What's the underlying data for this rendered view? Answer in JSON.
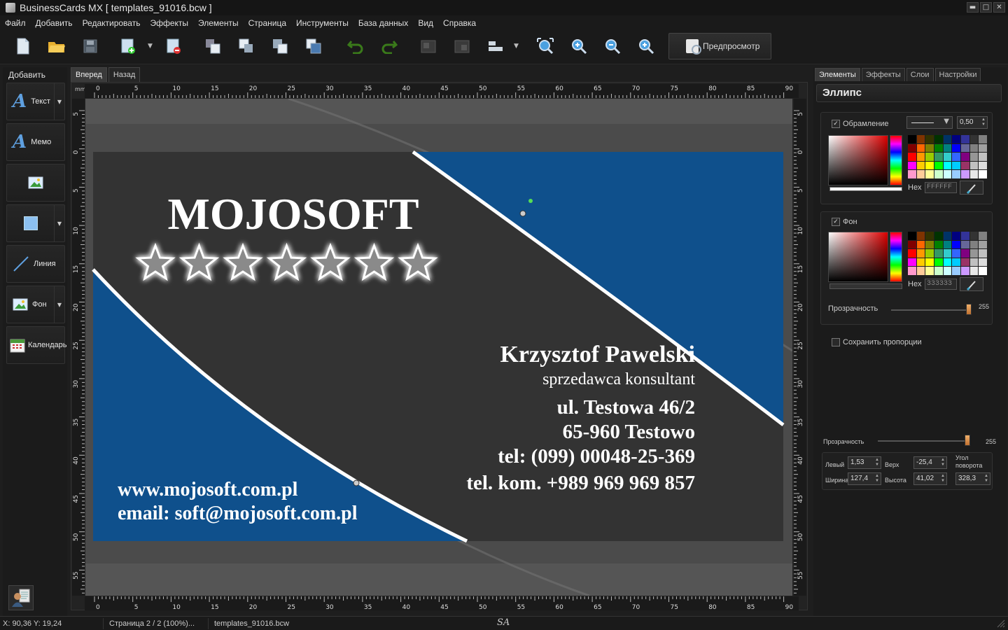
{
  "window": {
    "title": "BusinessCards MX [ templates_91016.bcw ]"
  },
  "menu": [
    "Файл",
    "Добавить",
    "Редактировать",
    "Эффекты",
    "Элементы",
    "Страница",
    "Инструменты",
    "База данных",
    "Вид",
    "Справка"
  ],
  "toolbar": {
    "preview_label": "Предпросмотр"
  },
  "left_panel": {
    "header": "Добавить",
    "buttons": [
      {
        "label": "Текст",
        "icon": "text-icon"
      },
      {
        "label": "Мемо",
        "icon": "memo-icon"
      },
      {
        "label": "",
        "icon": "image-icon"
      },
      {
        "label": "",
        "icon": "rectangle-icon"
      },
      {
        "label": "Линия",
        "icon": "line-icon"
      },
      {
        "label": "Фон",
        "icon": "background-icon"
      },
      {
        "label": "Календарь",
        "icon": "calendar-icon"
      }
    ]
  },
  "canvas_tabs": [
    "Вперед",
    "Назад"
  ],
  "ruler": {
    "unit": "mm",
    "h_labels": [
      "0",
      "5",
      "10",
      "15",
      "20",
      "25",
      "30",
      "35",
      "40",
      "45",
      "50",
      "55",
      "60",
      "65",
      "70",
      "75",
      "80",
      "85",
      "90"
    ],
    "v_labels": [
      "5",
      "0",
      "5",
      "10",
      "15",
      "20",
      "25",
      "30",
      "35",
      "40",
      "45",
      "50",
      "55"
    ]
  },
  "card": {
    "brand": "MOJOSOFT",
    "stars": 7,
    "name": "Krzysztof Pawelski",
    "role": "sprzedawca konsultant",
    "address1": "ul. Testowa 46/2",
    "address2": "65-960 Testowo",
    "tel": "tel: (099) 00048-25-369",
    "mobile": "tel. kom. +989 969 969 857",
    "web": "www.mojosoft.com.pl",
    "email": "email: soft@mojosoft.com.pl",
    "colors": {
      "dark": "#333333",
      "blue": "#0f508c",
      "white": "#ffffff"
    }
  },
  "right_panel": {
    "tabs": [
      "Элементы",
      "Эффекты",
      "Слои",
      "Настройки"
    ],
    "title": "Эллипс",
    "outline": {
      "label": "Обрамление",
      "checked": true,
      "width": "0,50",
      "hex_label": "Hex",
      "hex": "FFFFFF"
    },
    "fill": {
      "label": "Фон",
      "checked": true,
      "hex_label": "Hex",
      "hex": "333333",
      "opacity_label": "Прозрачность",
      "opacity": "255"
    },
    "keep_ratio": {
      "label": "Сохранить пропорции",
      "checked": false
    },
    "opacity_label": "Прозрачность",
    "opacity": "255",
    "geometry": {
      "left_label": "Левый",
      "left": "1,53",
      "top_label": "Верх",
      "top": "-25,4",
      "angle_label_1": "Угол",
      "angle_label_2": "поворота",
      "width_label": "Ширина",
      "width": "127,4",
      "height_label": "Высота",
      "height": "41,02",
      "angle": "328,3"
    }
  },
  "status": {
    "coords": "X: 90,36 Y: 19,24",
    "page": "Страница 2 / 2 (100%)...",
    "file": "templates_91016.bcw",
    "sa": "SA"
  }
}
